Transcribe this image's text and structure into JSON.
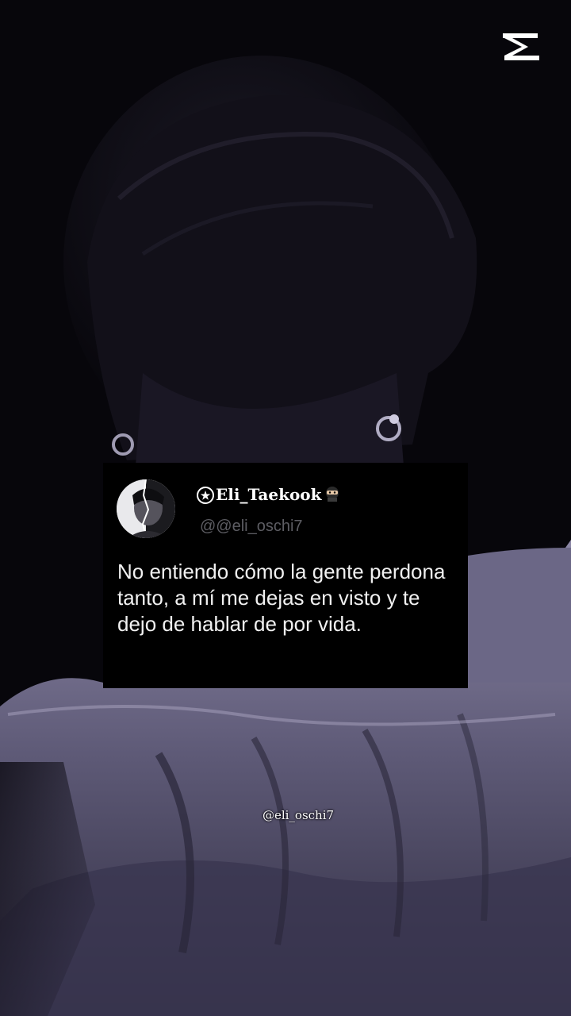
{
  "app": {
    "logo_icon": "capcut-logo-icon"
  },
  "tweet": {
    "display_name": "Eli_Taekook",
    "name_prefix_icon": "star-circle-icon",
    "name_suffix_icon": "ninja-emoji-icon",
    "handle": "@@eli_oschi7",
    "text": "No entiendo cómo la gente perdona tanto, a mí me dejas en visto y te dejo de hablar de por vida.",
    "avatar_icon": "profile-avatar"
  },
  "watermark": {
    "text": "@eli_oschi7"
  },
  "colors": {
    "background": "#07060b",
    "card": "#000000",
    "handle": "#5d5d63",
    "text": "#f1f1f1"
  }
}
